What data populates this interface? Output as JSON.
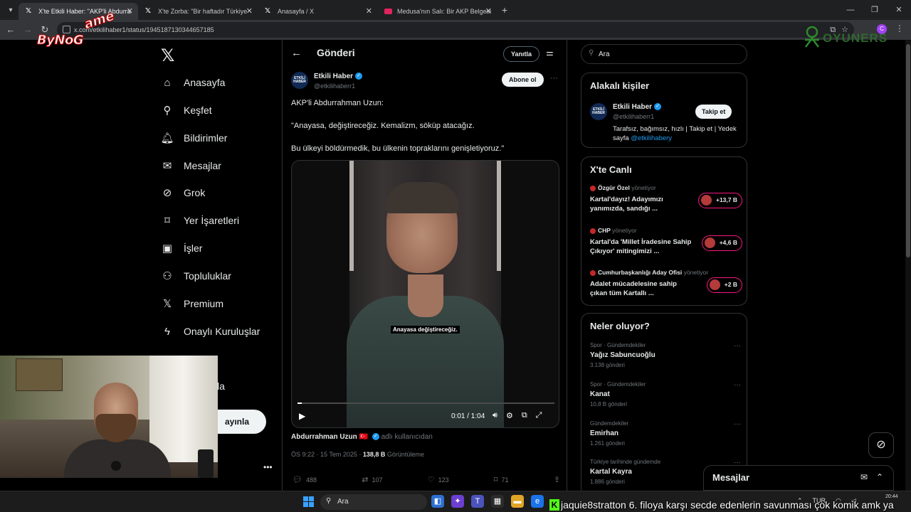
{
  "browser": {
    "tabs": [
      {
        "title": "X'te Etkili Haber: \"AKP'li Abdurra",
        "icon": "x-icon",
        "active": true
      },
      {
        "title": "X'te Zorba: \"Bir haftadır Türkiye",
        "icon": "x-icon",
        "active": false
      },
      {
        "title": "Anasayfa / X",
        "icon": "x-icon",
        "active": false
      },
      {
        "title": "Medusa'nın Salı: Bir AKP Belgesi",
        "icon": "youtube-icon",
        "active": false
      }
    ],
    "url": "x.com/etkilihaber1/status/1945187130344657185",
    "profile_initial": "C"
  },
  "overlay": {
    "byno_text": "ByNoG",
    "byno_game": "ame",
    "oyuners_text": "OYUNERS"
  },
  "nav": {
    "items": [
      {
        "label": "Anasayfa",
        "icon": "home-icon"
      },
      {
        "label": "Keşfet",
        "icon": "search-icon"
      },
      {
        "label": "Bildirimler",
        "icon": "bell-icon"
      },
      {
        "label": "Mesajlar",
        "icon": "mail-icon"
      },
      {
        "label": "Grok",
        "icon": "grok-icon"
      },
      {
        "label": "Yer İşaretleri",
        "icon": "bookmark-icon"
      },
      {
        "label": "İşler",
        "icon": "briefcase-icon"
      },
      {
        "label": "Topluluklar",
        "icon": "people-icon"
      },
      {
        "label": "Premium",
        "icon": "x-icon"
      },
      {
        "label": "Onaylı Kuruluşlar",
        "icon": "lightning-icon"
      }
    ],
    "partial_more": "zla",
    "post_button": "ayınla"
  },
  "main": {
    "header_title": "Gönderi",
    "reply_button": "Yanıtla",
    "author": {
      "name": "Etkili Haber",
      "handle": "@etkilihaberr1",
      "avatar_text": "ETKİLİ HABER"
    },
    "follow_button": "Abone ol",
    "text_lines": [
      "AKP'li Abdurrahman Uzun:",
      "\"Anayasa, değiştireceğiz. Kemalizm, söküp atacağız.",
      "Bu ülkeyi böldürmedik, bu ülkenin topraklarını genişletiyoruz.\""
    ],
    "video": {
      "caption": "Anayasa değiştireceğiz.",
      "time": "0:01 / 1:04",
      "progress": 0.016
    },
    "attribution": {
      "name": "Abdurrahman Uzun",
      "suffix": "adlı kullanıcıdan"
    },
    "meta": {
      "time": "ÖS 9:22 · 15 Tem 2025 · ",
      "views": "138,8 B",
      "views_label": " Görüntüleme"
    },
    "actions": {
      "replies": "488",
      "reposts": "107",
      "likes": "123",
      "bookmarks": "71"
    }
  },
  "sidebar": {
    "search_placeholder": "Ara",
    "related": {
      "title": "Alakalı kişiler",
      "name": "Etkili Haber",
      "handle": "@etkilihaberr1",
      "follow": "Takip et",
      "bio": "Tarafsız, bağımsız, hızlı | Takip et | Yedek sayfa ",
      "bio_link": "@etkilihabery"
    },
    "live": {
      "title": "X'te Canlı",
      "items": [
        {
          "host": "Özgür Özel",
          "role": "yönetiyor",
          "title": "Kartal'dayız! Adayımızı yanımızda, sandığı ...",
          "count": "+13,7 B"
        },
        {
          "host": "CHP",
          "role": "yönetiyor",
          "title": "Kartal'da 'Millet İradesine Sahip Çıkıyor' mitingimizi ...",
          "count": "+4,6 B"
        },
        {
          "host": "Cumhurbaşkanlığı Aday Ofisi",
          "role": "yönetiyor",
          "title": "Adalet mücadelesine sahip çıkan tüm Kartallı ...",
          "count": "+2 B"
        }
      ]
    },
    "trends": {
      "title": "Neler oluyor?",
      "items": [
        {
          "category": "Spor · Gündemdekiler",
          "name": "Yağız Sabuncuoğlu",
          "count": "3.138 gönderi"
        },
        {
          "category": "Spor · Gündemdekiler",
          "name": "Kanat",
          "count": "10,8 B gönderi"
        },
        {
          "category": "Gündemdekiler",
          "name": "Emirhan",
          "count": "1.261 gönderi"
        },
        {
          "category": "Türkiye tarihinde gündemde",
          "name": "Kartal Kayra",
          "count": "1.886 gönderi"
        }
      ]
    }
  },
  "messages_dock": {
    "title": "Mesajlar"
  },
  "taskbar": {
    "search_placeholder": "Ara",
    "time": "20:44",
    "lang": "TUR"
  },
  "stream": {
    "ticker_user": "jaquie8stratton",
    "ticker_text": " 6. filoya karşı secde edenlerin savunması çok komik amk ya"
  },
  "colors": {
    "accent": "#1d9bf0",
    "live_border": "#f91880",
    "background": "#000000"
  }
}
